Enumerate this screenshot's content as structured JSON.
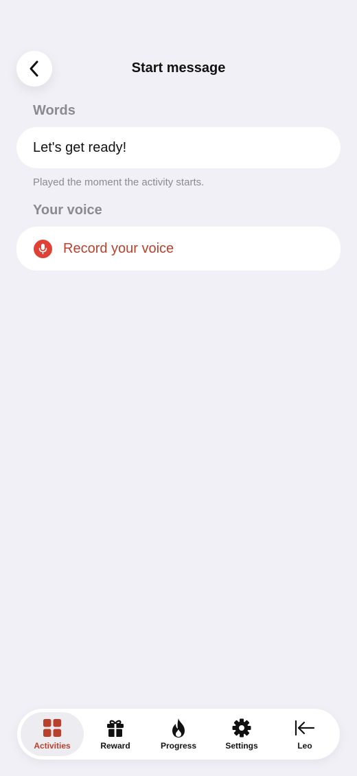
{
  "header": {
    "title": "Start message",
    "back_icon": "chevron-left-icon"
  },
  "words": {
    "label": "Words",
    "value": "Let's get ready!",
    "hint": "Played the moment the activity starts."
  },
  "voice": {
    "label": "Your voice",
    "record_label": "Record your voice",
    "icon": "microphone-icon"
  },
  "tabbar": {
    "tabs": [
      {
        "label": "Activities",
        "icon": "grid-icon",
        "active": true
      },
      {
        "label": "Reward",
        "icon": "gift-icon",
        "active": false
      },
      {
        "label": "Progress",
        "icon": "flame-icon",
        "active": false
      },
      {
        "label": "Settings",
        "icon": "gear-icon",
        "active": false
      },
      {
        "label": "Leo",
        "icon": "arrow-left-bar-icon",
        "active": false
      }
    ]
  },
  "colors": {
    "background": "#f1f0f6",
    "accent": "#b8412d",
    "mic": "#df4137",
    "muted_text": "#8a8a90"
  }
}
